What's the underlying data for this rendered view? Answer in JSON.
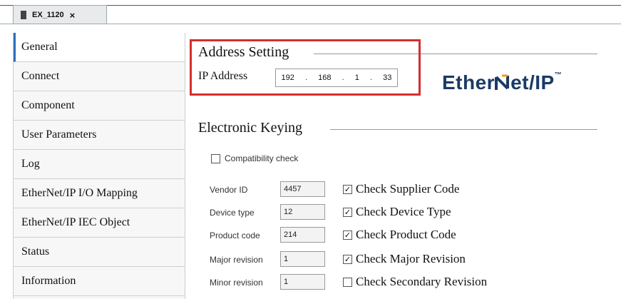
{
  "tab": {
    "title": "EX_1120",
    "close": "×"
  },
  "sidebar": {
    "items": [
      {
        "label": "General"
      },
      {
        "label": "Connect"
      },
      {
        "label": "Component"
      },
      {
        "label": "User Parameters"
      },
      {
        "label": "Log"
      },
      {
        "label": "EtherNet/IP I/O Mapping"
      },
      {
        "label": "EtherNet/IP IEC Object"
      },
      {
        "label": "Status"
      },
      {
        "label": "Information"
      }
    ]
  },
  "address": {
    "group_title": "Address Setting",
    "ip_label": "IP Address",
    "ip": [
      "192",
      "168",
      "1",
      "33"
    ]
  },
  "logo": {
    "text_left": "Ether",
    "text_right": "et/IP"
  },
  "keying": {
    "group_title": "Electronic Keying",
    "compat_label": "Compatibility check",
    "rows": [
      {
        "label": "Vendor ID",
        "value": "4457",
        "check_label": "Check Supplier Code",
        "checked": true
      },
      {
        "label": "Device type",
        "value": "12",
        "check_label": "Check Device Type",
        "checked": true
      },
      {
        "label": "Product code",
        "value": "214",
        "check_label": "Check Product Code",
        "checked": true
      },
      {
        "label": "Major revision",
        "value": "1",
        "check_label": "Check Major Revision",
        "checked": true
      },
      {
        "label": "Minor revision",
        "value": "1",
        "check_label": "Check Secondary Revision",
        "checked": false
      }
    ]
  },
  "colors": {
    "accent": "#2c6fbb",
    "highlight": "#d32f2f",
    "logo": "#1b3a66"
  }
}
